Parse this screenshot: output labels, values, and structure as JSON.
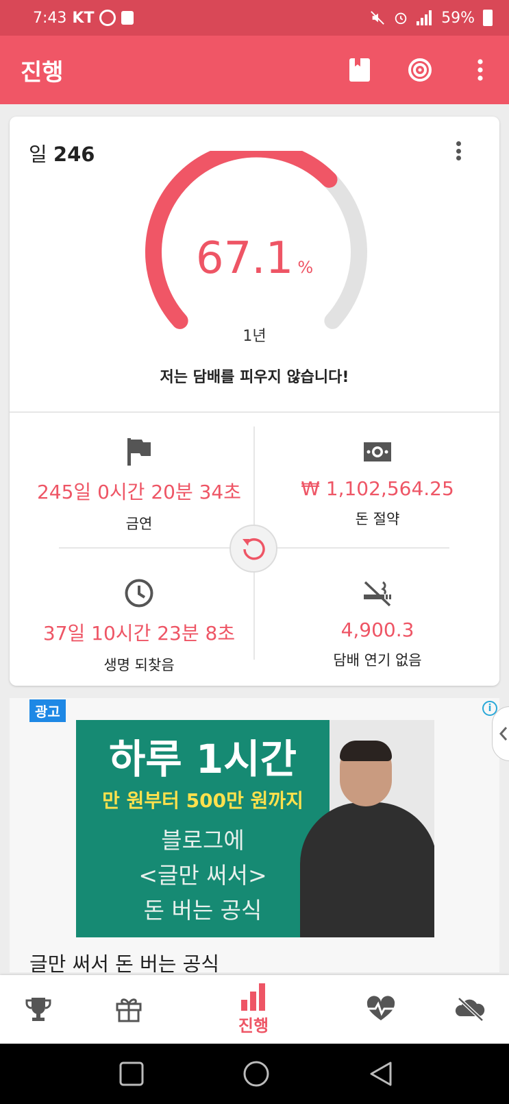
{
  "status_bar": {
    "time": "7:43",
    "carrier": "KT",
    "battery": "59%"
  },
  "app_bar": {
    "title": "진행",
    "actions": [
      "book-icon",
      "target-icon",
      "more-vert-icon"
    ]
  },
  "card": {
    "day_prefix": "일",
    "day_number": "246",
    "gauge": {
      "percent_value": "67.1",
      "percent_unit": "%",
      "progress": 0.671,
      "end_label": "1년"
    },
    "motto": "저는 담배를 피우지 않습니다!",
    "stats": [
      {
        "icon": "flag-icon",
        "value": "245일 0시간 20분 34초",
        "label": "금연"
      },
      {
        "icon": "money-icon",
        "value": "₩ 1,102,564.25",
        "label": "돈 절약"
      },
      {
        "icon": "clock-icon",
        "value": "37일 10시간 23분 8초",
        "label": "생명 되찾음"
      },
      {
        "icon": "no-smoking-icon",
        "value": "4,900.3",
        "label": "담배 연기 없음"
      }
    ]
  },
  "ad": {
    "badge": "광고",
    "banner_title": "하루 1시간",
    "banner_subtitle": "만 원부터 500만 원까지",
    "banner_line1": "블로그에",
    "banner_line2": "<글만 써서>",
    "banner_line3": "돈 버는 공식",
    "caption": "글만 써서 돈 버는 공식"
  },
  "bottom_nav": {
    "items": [
      {
        "icon": "trophy-icon",
        "label": ""
      },
      {
        "icon": "gift-icon",
        "label": ""
      },
      {
        "icon": "bar-chart-icon",
        "label": "진행"
      },
      {
        "icon": "heartbeat-icon",
        "label": ""
      },
      {
        "icon": "no-smoking-icon",
        "label": ""
      }
    ],
    "active_index": 2
  },
  "colors": {
    "primary": "#f05666",
    "status_bar": "#d94857",
    "accent_text": "#ee5565",
    "gauge_track": "#e2e2e2",
    "ad_green": "#168a73",
    "ad_yellow": "#ffe14d"
  }
}
